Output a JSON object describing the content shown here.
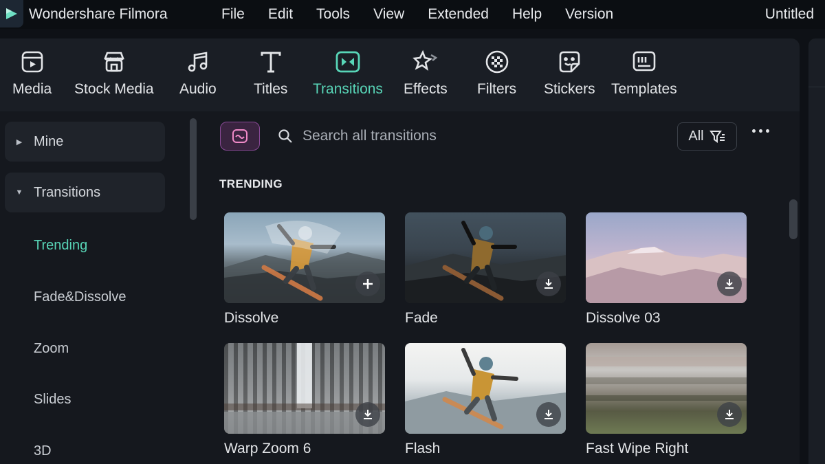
{
  "app": {
    "name": "Wondershare Filmora",
    "document_title": "Untitled",
    "accent_color": "#58d5b7"
  },
  "menu": [
    "File",
    "Edit",
    "Tools",
    "View",
    "Extended",
    "Help",
    "Version"
  ],
  "toolbar": {
    "active": "Transitions",
    "items": [
      {
        "label": "Media",
        "icon": "media-icon"
      },
      {
        "label": "Stock Media",
        "icon": "stock-media-icon"
      },
      {
        "label": "Audio",
        "icon": "music-note-icon"
      },
      {
        "label": "Titles",
        "icon": "text-t-icon"
      },
      {
        "label": "Transitions",
        "icon": "transitions-icon"
      },
      {
        "label": "Effects",
        "icon": "sparkle-icon"
      },
      {
        "label": "Filters",
        "icon": "filter-icon"
      },
      {
        "label": "Stickers",
        "icon": "sticker-icon"
      },
      {
        "label": "Templates",
        "icon": "templates-icon"
      }
    ]
  },
  "sidebar": {
    "groups": [
      {
        "label": "Mine",
        "expanded": false
      },
      {
        "label": "Transitions",
        "expanded": true
      }
    ],
    "items": [
      "Trending",
      "Fade&Dissolve",
      "Zoom",
      "Slides",
      "3D"
    ],
    "active_item": "Trending"
  },
  "search": {
    "placeholder": "Search all transitions",
    "filter_label": "All"
  },
  "section": {
    "title": "TRENDING"
  },
  "transitions": [
    {
      "label": "Dissolve",
      "action": "add"
    },
    {
      "label": "Fade",
      "action": "download"
    },
    {
      "label": "Dissolve 03",
      "action": "download"
    },
    {
      "label": "Warp Zoom 6",
      "action": "download"
    },
    {
      "label": "Flash",
      "action": "download"
    },
    {
      "label": "Fast Wipe Right",
      "action": "download"
    }
  ]
}
